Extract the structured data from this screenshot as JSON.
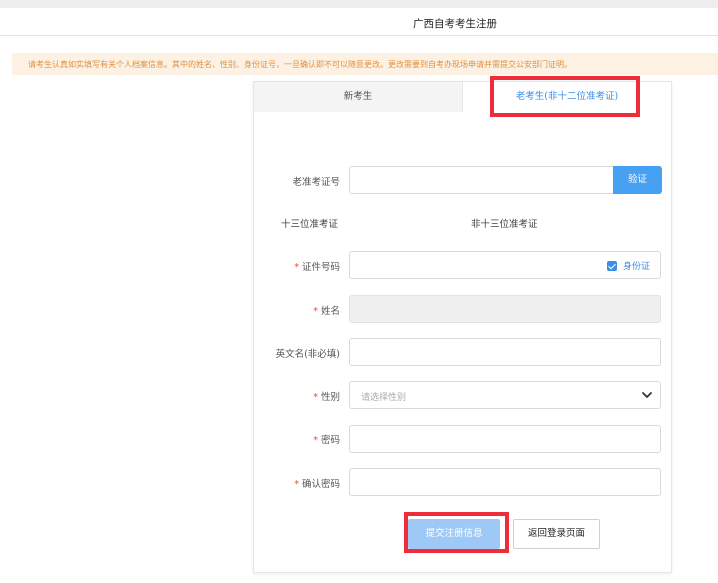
{
  "header": {
    "title": "广西自考考生注册"
  },
  "notice": {
    "text": "请考生认真如实填写有关个人档案信息。其中的姓名、性别、身份证号，一旦确认即不可以随意更改。更改需要到自考办现场申请并需提交公安部门证明。"
  },
  "tabs": [
    {
      "label": "新考生",
      "active": false
    },
    {
      "label": "老考生(非十二位准考证)",
      "active": true
    }
  ],
  "form": {
    "old_ticket": {
      "label": "老准考证号",
      "value": "",
      "verify_label": "验证"
    },
    "static": {
      "left": "十三位准考证",
      "right": "非十三位准考证"
    },
    "id_number": {
      "label": "证件号码",
      "required": true,
      "value": "",
      "id_type": "身份证",
      "id_type_checked": true
    },
    "name": {
      "label": "姓名",
      "required": true,
      "value": ""
    },
    "english_name": {
      "label": "英文名(非必填)",
      "value": ""
    },
    "gender": {
      "label": "性别",
      "required": true,
      "placeholder": "请选择性别"
    },
    "password": {
      "label": "密码",
      "required": true,
      "value": ""
    },
    "confirm_password": {
      "label": "确认密码",
      "required": true,
      "value": ""
    },
    "required_mark": "*"
  },
  "actions": {
    "submit_label": "提交注册信息",
    "back_label": "返回登录页面"
  },
  "colors": {
    "accent": "#47a1f3",
    "highlight": "#ee2d3a",
    "notice_text": "#e0913f",
    "notice_bg": "#fdf1e3"
  }
}
